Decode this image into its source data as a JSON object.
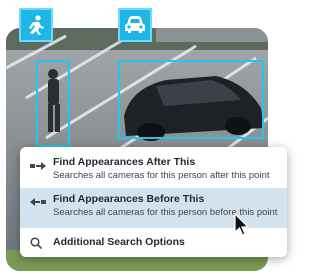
{
  "overlay": {
    "person_icon": "person-running-icon",
    "car_icon": "car-icon",
    "accent_color": "#1fb6e6"
  },
  "menu": {
    "items": [
      {
        "title": "Find Appearances After This",
        "subtitle": "Searches all cameras for this person after this point",
        "icon": "arrow-right-icon"
      },
      {
        "title": "Find Appearances Before This",
        "subtitle": "Searches all cameras for this person before this point",
        "icon": "arrow-left-icon",
        "highlighted": true
      },
      {
        "title": "Additional Search Options",
        "icon": "search-icon"
      }
    ]
  }
}
